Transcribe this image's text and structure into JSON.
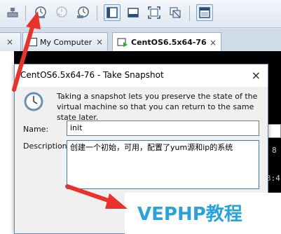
{
  "toolbar": {
    "buttons": [
      {
        "name": "settings-icon"
      },
      {
        "name": "take-snapshot-icon"
      },
      {
        "name": "revert-snapshot-icon"
      },
      {
        "name": "snapshot-manager-icon"
      },
      {
        "name": "console-view-icon"
      },
      {
        "name": "fullscreen-bar-icon"
      },
      {
        "name": "fit-window-icon"
      },
      {
        "name": "unity-icon"
      },
      {
        "name": "thumbnail-view-icon"
      }
    ]
  },
  "tabs": [
    {
      "label": "",
      "close": "×"
    },
    {
      "label": "My Computer",
      "close": "×"
    },
    {
      "label": "CentOS6.5x64-76",
      "close": "×"
    }
  ],
  "console": {
    "text1": "8",
    "text2": "3:4"
  },
  "dialog": {
    "title": "CentOS6.5x64-76 - Take Snapshot",
    "close": "×",
    "description": "Taking a snapshot lets you preserve the state of the virtual machine so that you can return to the same state later.",
    "name_label": "Name:",
    "name_value": "init",
    "desc_label": "Description:",
    "desc_value": "创建一个初始，可用，配置了yum源和ip的系统"
  },
  "watermark": {
    "text": "VEPHP教程"
  },
  "colors": {
    "arrow": "#e8322b",
    "watermark": "#2aa3dc"
  }
}
